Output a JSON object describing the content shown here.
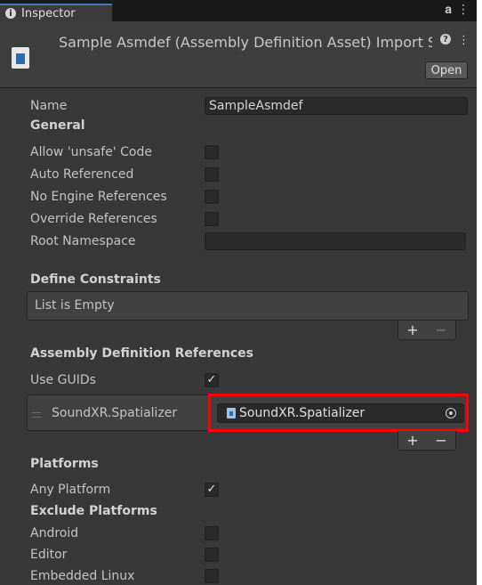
{
  "window": {
    "tab_label": "Inspector",
    "lock_icon": "lock-icon",
    "menu_icon": "kebab-menu-icon"
  },
  "header": {
    "title": "Sample Asmdef (Assembly Definition Asset) Import Se",
    "open_label": "Open"
  },
  "name": {
    "label": "Name",
    "value": "SampleAsmdef"
  },
  "general": {
    "title": "General",
    "allow_unsafe": {
      "label": "Allow 'unsafe' Code",
      "checked": false
    },
    "auto_referenced": {
      "label": "Auto Referenced",
      "checked": false
    },
    "no_engine_refs": {
      "label": "No Engine References",
      "checked": false
    },
    "override_refs": {
      "label": "Override References",
      "checked": false
    },
    "root_namespace": {
      "label": "Root Namespace",
      "value": ""
    }
  },
  "define_constraints": {
    "title": "Define Constraints",
    "empty_text": "List is Empty",
    "plus": "+",
    "minus": "−"
  },
  "assembly_refs": {
    "title": "Assembly Definition References",
    "use_guids": {
      "label": "Use GUIDs",
      "checked": true,
      "mark": "✓"
    },
    "items": [
      {
        "label": "SoundXR.Spatializer",
        "value": "SoundXR.Spatializer"
      }
    ],
    "plus": "+",
    "minus": "−"
  },
  "platforms": {
    "title": "Platforms",
    "any_platform": {
      "label": "Any Platform",
      "checked": true,
      "mark": "✓"
    },
    "exclude_title": "Exclude Platforms",
    "items": [
      {
        "label": "Android",
        "checked": false
      },
      {
        "label": "Editor",
        "checked": false
      },
      {
        "label": "Embedded Linux",
        "checked": false
      }
    ]
  },
  "colors": {
    "highlight": "#ff0000",
    "tab_accent": "#3a79bb",
    "panel_bg": "#383838"
  }
}
